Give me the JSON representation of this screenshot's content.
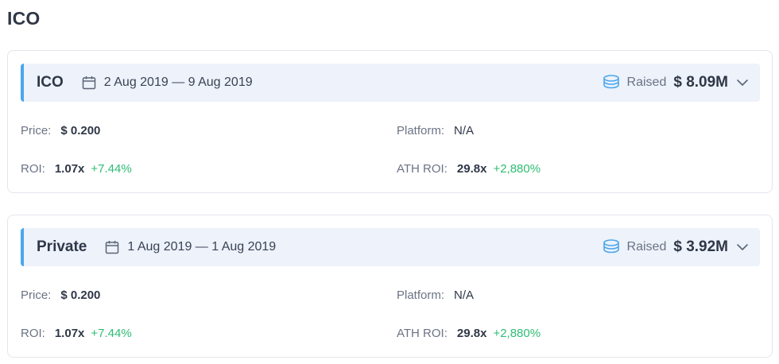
{
  "page": {
    "title": "ICO"
  },
  "colors": {
    "accent": "#4aa6ee",
    "header_bg": "#edf2fb",
    "positive": "#2ebd74"
  },
  "rounds": [
    {
      "name": "ICO",
      "dates": "2 Aug 2019 — 9 Aug 2019",
      "raised_label": "Raised",
      "raised_value": "$ 8.09M",
      "price_label": "Price:",
      "price_value": "$ 0.200",
      "platform_label": "Platform:",
      "platform_value": "N/A",
      "roi_label": "ROI:",
      "roi_value": "1.07x",
      "roi_change": "+7.44%",
      "ath_roi_label": "ATH ROI:",
      "ath_roi_value": "29.8x",
      "ath_roi_change": "+2,880%",
      "icons": {
        "date": "calendar-icon",
        "raised": "coins-icon",
        "toggle": "chevron-down-icon"
      }
    },
    {
      "name": "Private",
      "dates": "1 Aug 2019 — 1 Aug 2019",
      "raised_label": "Raised",
      "raised_value": "$ 3.92M",
      "price_label": "Price:",
      "price_value": "$ 0.200",
      "platform_label": "Platform:",
      "platform_value": "N/A",
      "roi_label": "ROI:",
      "roi_value": "1.07x",
      "roi_change": "+7.44%",
      "ath_roi_label": "ATH ROI:",
      "ath_roi_value": "29.8x",
      "ath_roi_change": "+2,880%",
      "icons": {
        "date": "calendar-icon",
        "raised": "coins-icon",
        "toggle": "chevron-down-icon"
      }
    }
  ]
}
